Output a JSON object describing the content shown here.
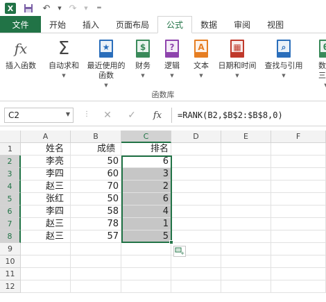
{
  "tabs": [
    "文件",
    "开始",
    "插入",
    "页面布局",
    "公式",
    "数据",
    "审阅",
    "视图"
  ],
  "active_tab": "公式",
  "ribbon": {
    "buttons": [
      {
        "name": "insert-function",
        "label": "插入函数",
        "icon": "fx-icon",
        "glyph": "fx",
        "color": "#555555"
      },
      {
        "name": "autosum",
        "label": "自动求和",
        "icon": "sigma-icon",
        "glyph": "Σ",
        "color": "#444444"
      },
      {
        "name": "recently-used",
        "label": "最近使用的\n函数",
        "icon": "star-book-icon",
        "glyph": "★",
        "color": "#2a6ebb"
      },
      {
        "name": "financial",
        "label": "财务",
        "icon": "coins-book-icon",
        "glyph": "$",
        "color": "#3a8a5a"
      },
      {
        "name": "logical",
        "label": "逻辑",
        "icon": "question-book-icon",
        "glyph": "?",
        "color": "#8e44ad"
      },
      {
        "name": "text",
        "label": "文本",
        "icon": "text-book-icon",
        "glyph": "A",
        "color": "#e67e22"
      },
      {
        "name": "date-time",
        "label": "日期和时间",
        "icon": "calendar-book-icon",
        "glyph": "▦",
        "color": "#c0392b"
      },
      {
        "name": "lookup",
        "label": "查找与引用",
        "icon": "search-book-icon",
        "glyph": "⌕",
        "color": "#2a6ebb"
      },
      {
        "name": "math-trig",
        "label": "数学\n三角",
        "icon": "math-book-icon",
        "glyph": "θ",
        "color": "#3a8a5a"
      }
    ],
    "group_label": "函数库"
  },
  "formula_bar": {
    "name_box": "C2",
    "cancel_glyph": "✕",
    "enter_glyph": "✓",
    "fx_glyph": "fx",
    "formula": "=RANK(B2,$B$2:$B$8,0)"
  },
  "sheet": {
    "columns": [
      "A",
      "B",
      "C",
      "D",
      "E",
      "F"
    ],
    "rows": [
      "1",
      "2",
      "3",
      "4",
      "5",
      "6",
      "7",
      "8",
      "9",
      "10",
      "11",
      "12"
    ],
    "headers": {
      "a": "姓名",
      "b": "成绩",
      "c": "排名"
    },
    "data": [
      {
        "name": "李亮",
        "score": "50",
        "rank": "6"
      },
      {
        "name": "李四",
        "score": "60",
        "rank": "3"
      },
      {
        "name": "赵三",
        "score": "70",
        "rank": "2"
      },
      {
        "name": "张红",
        "score": "50",
        "rank": "6"
      },
      {
        "name": "李四",
        "score": "58",
        "rank": "4"
      },
      {
        "name": "赵三",
        "score": "78",
        "rank": "1"
      },
      {
        "name": "赵三",
        "score": "57",
        "rank": "5"
      }
    ]
  },
  "colors": {
    "accent": "#217346",
    "selection_fill": "#c6c6c6"
  }
}
